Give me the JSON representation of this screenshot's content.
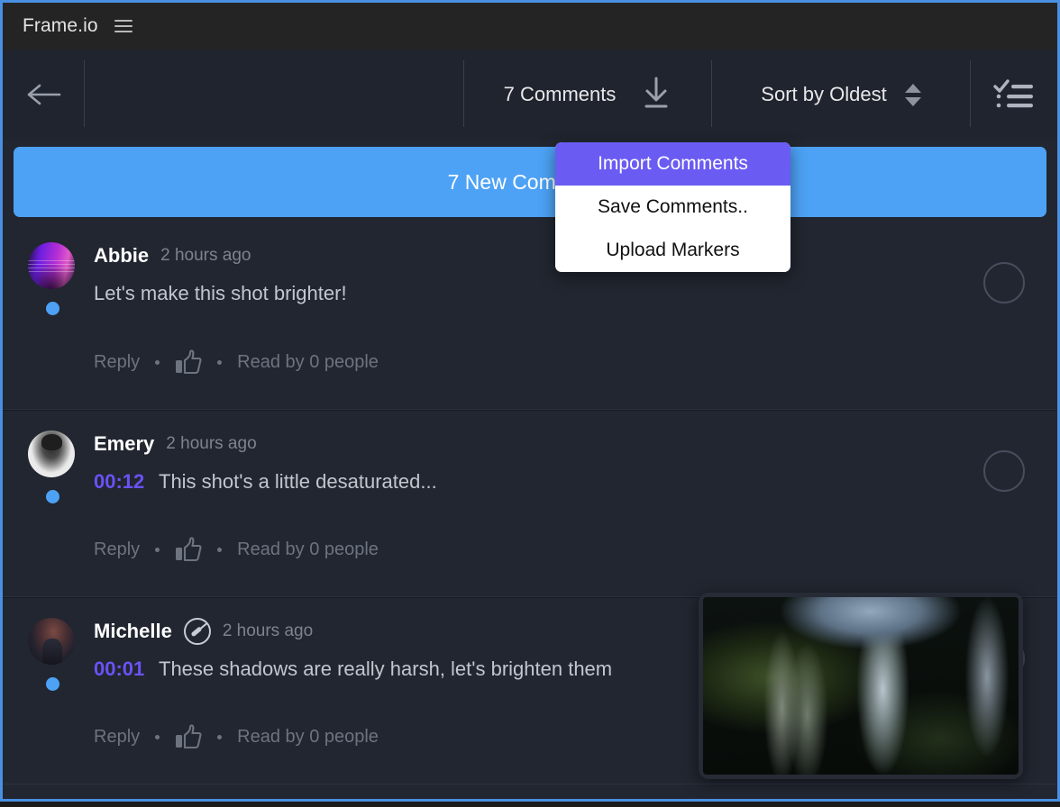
{
  "window": {
    "border_color": "#4a90e2",
    "background": "#212630"
  },
  "titlebar": {
    "brand": "Frame.io",
    "menu_icon": "hamburger-icon"
  },
  "toolbar": {
    "back_icon": "back-arrow-icon",
    "comment_count_label": "7 Comments",
    "download_icon": "download-icon",
    "sort_label": "Sort by Oldest",
    "sort_stepper_icon": "sort-updown-icon",
    "checklist_icon": "checklist-icon"
  },
  "banner": {
    "label": "7 New Comments",
    "color": "#4da2f5"
  },
  "dropdown": {
    "items": [
      {
        "label": "Import Comments",
        "highlighted": true
      },
      {
        "label": "Save Comments..",
        "highlighted": false
      },
      {
        "label": "Upload Markers",
        "highlighted": false
      }
    ],
    "highlight_color": "#6a5cf2"
  },
  "comments": [
    {
      "author": "Abbie",
      "time": "2 hours ago",
      "timestamp": "",
      "text": "Let's make this shot brighter!",
      "has_badge": false,
      "reply_label": "Reply",
      "like_icon": "thumbs-up-icon",
      "read_label": "Read by 0 people",
      "unread": true
    },
    {
      "author": "Emery",
      "time": "2 hours ago",
      "timestamp": "00:12",
      "text": "This shot's a little desaturated...",
      "has_badge": false,
      "reply_label": "Reply",
      "like_icon": "thumbs-up-icon",
      "read_label": "Read by 0 people",
      "unread": true
    },
    {
      "author": "Michelle",
      "time": "2 hours ago",
      "timestamp": "00:01",
      "text": "These shadows are really harsh, let's brighten them",
      "has_badge": true,
      "badge_icon": "brush-badge-icon",
      "reply_label": "Reply",
      "like_icon": "thumbs-up-icon",
      "read_label": "Read by 0 people",
      "unread": true
    }
  ],
  "thumbnail": {
    "name": "video-preview-thumbnail",
    "description": "dark forest with tall trees"
  }
}
